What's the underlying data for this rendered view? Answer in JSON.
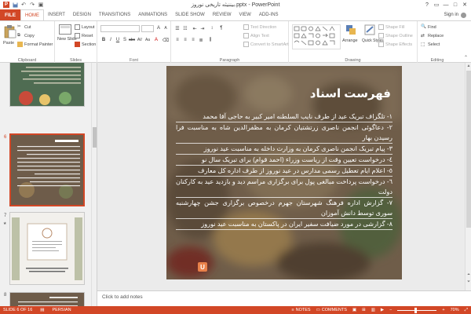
{
  "window": {
    "title": "بیننیثه تاریخی نوروز.pptx - PowerPoint",
    "minimize": "—",
    "maximize": "□",
    "close": "✕"
  },
  "qat": {
    "save": "💾",
    "undo": "↶",
    "redo": "↷",
    "start": "▣"
  },
  "tabs": {
    "file": "FILE",
    "items": [
      "HOME",
      "INSERT",
      "DESIGN",
      "TRANSITIONS",
      "ANIMATIONS",
      "SLIDE SHOW",
      "REVIEW",
      "VIEW",
      "ADD-INS"
    ],
    "active_index": 0,
    "sign_in": "Sign in"
  },
  "ribbon": {
    "clipboard": {
      "label": "Clipboard",
      "paste": "Paste",
      "cut": "Cut",
      "copy": "Copy",
      "format_painter": "Format Painter"
    },
    "slides": {
      "label": "Slides",
      "new_slide": "New Slide",
      "layout": "Layout",
      "reset": "Reset",
      "section": "Section"
    },
    "font": {
      "label": "Font",
      "bold": "B",
      "italic": "I",
      "underline": "U",
      "shadow": "S",
      "strike": "abc",
      "spacing": "AV",
      "case": "Aa",
      "color": "A",
      "grow": "A",
      "shrink": "A",
      "clear": "⌫"
    },
    "paragraph": {
      "label": "Paragraph",
      "text_direction": "Text Direction",
      "align_text": "Align Text",
      "convert_smartart": "Convert to SmartArt"
    },
    "drawing": {
      "label": "Drawing",
      "arrange": "Arrange",
      "quick_styles": "Quick Styles",
      "shape_fill": "Shape Fill",
      "shape_outline": "Shape Outline",
      "shape_effects": "Shape Effects"
    },
    "editing": {
      "label": "Editing",
      "find": "Find",
      "replace": "Replace",
      "select": "Select"
    }
  },
  "thumbnails": [
    {
      "number": "",
      "active": false
    },
    {
      "number": "6",
      "active": true
    },
    {
      "number": "7",
      "active": false
    },
    {
      "number": "8",
      "active": false
    }
  ],
  "slide": {
    "title": "فهرست اسناد",
    "items": [
      "۱- تلگراف تبریک عید از طرف نایب السلطنه امیر کبیر به حاجی آقا محمد",
      "۲- دعاگوئی انجمن ناصری زرتشتیان کرمان به مظفرالدین شاه به مناسبت فرا رسیدن بهار",
      "۳- پیام تبریک انجمن ناصری کرمان به وزارت داخله به مناسبت عید نوروز",
      "٤- درخواست تعیین وقت از ریاست وزراء (احمد قوام) برای تبریک سال نو",
      "٥- اعلام ایام تعطیل رسمی مدارس در عید نوروز از طرف اداره کل معارف",
      "٦- درخواست پرداخت مبالغی پول برای برگزاری مراسم دید و بازدید عید به کارکنان دولت",
      "۷- گزارش اداره فرهنگ شهرستان جهرم درخصوص برگزاری جشن چهارشنبه سوری توسط دانش آموزان",
      "۸- گزارشی در مورد ضیافت سفیر ایران در پاکستان به مناسبت عید نوروز"
    ],
    "logo": "U"
  },
  "notes_placeholder": "Click to add notes",
  "status": {
    "slide_info": "SLIDE 6 OF 16",
    "language": "PERSIAN",
    "notes": "NOTES",
    "comments": "COMMENTS",
    "zoom": "70%"
  },
  "colors": {
    "accent": "#d24726",
    "slide_bg": "#8d7965"
  }
}
